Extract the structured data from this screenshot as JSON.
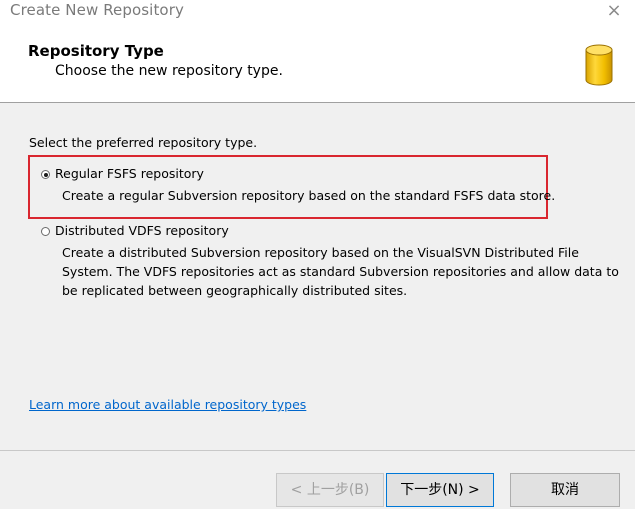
{
  "window": {
    "title": "Create New Repository",
    "close_icon": "×"
  },
  "header": {
    "title": "Repository Type",
    "subtitle": "Choose the new repository type.",
    "icon": "database-cylinder-icon",
    "icon_color": "#f5c400"
  },
  "content": {
    "prompt": "Select the preferred repository type.",
    "options": [
      {
        "label": "Regular FSFS repository",
        "selected": true,
        "description_lines": [
          "Create a regular Subversion repository based on the standard FSFS data store."
        ]
      },
      {
        "label": "Distributed VDFS repository",
        "selected": false,
        "description_lines": [
          "Create a distributed Subversion repository based on the VisualSVN Distributed File",
          "System. The VDFS repositories act as standard Subversion repositories and allow data to",
          "be replicated between geographically distributed sites."
        ]
      }
    ],
    "learn_more_link": "Learn more about available repository types",
    "highlight_color": "#d9262f",
    "link_color": "#0066cc"
  },
  "footer": {
    "back_label": "< 上一步(B)",
    "next_label": "下一步(N) >",
    "cancel_label": "取消"
  }
}
